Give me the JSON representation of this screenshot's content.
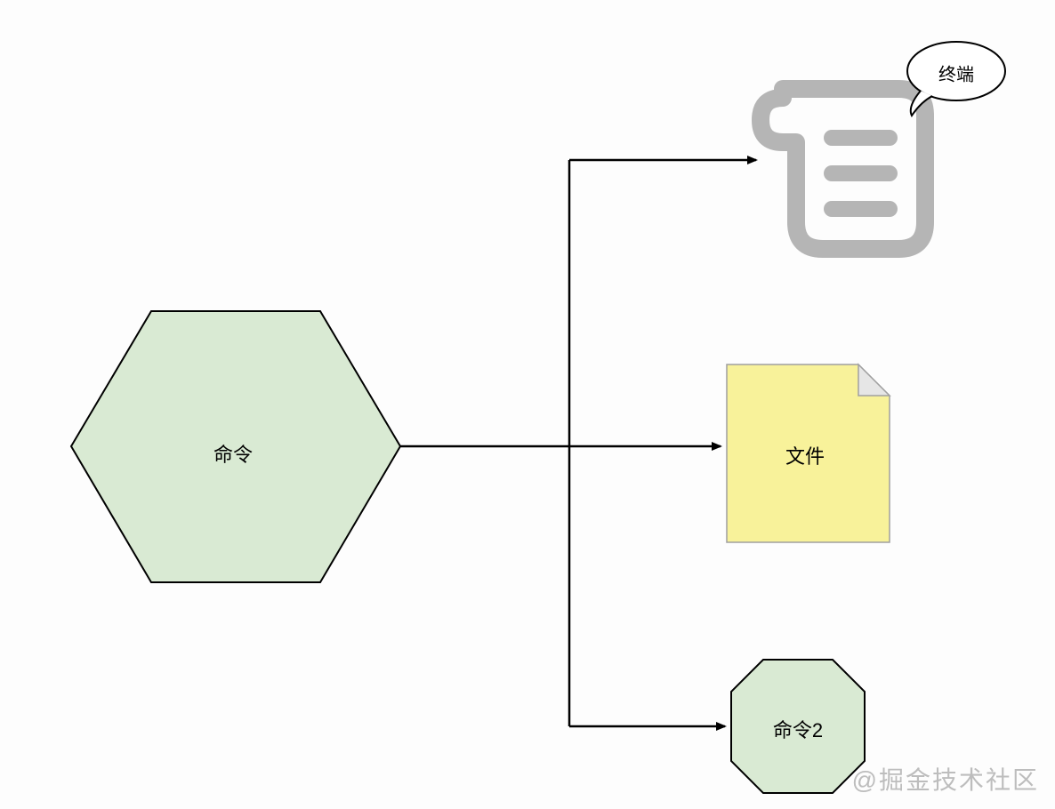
{
  "nodes": {
    "command": {
      "label": "命令"
    },
    "file": {
      "label": "文件"
    },
    "command2": {
      "label": "命令2"
    },
    "terminal_bubble": {
      "label": "终端"
    }
  },
  "watermark": "@掘金技术社区",
  "colors": {
    "hex_fill": "#d9ead3",
    "hex_stroke": "#000000",
    "file_fill": "#f8f29a",
    "file_stroke": "#a0a0a0",
    "oct_fill": "#d9ead3",
    "oct_stroke": "#000000",
    "scroll_stroke": "#b5b5b5",
    "arrow": "#000000"
  }
}
